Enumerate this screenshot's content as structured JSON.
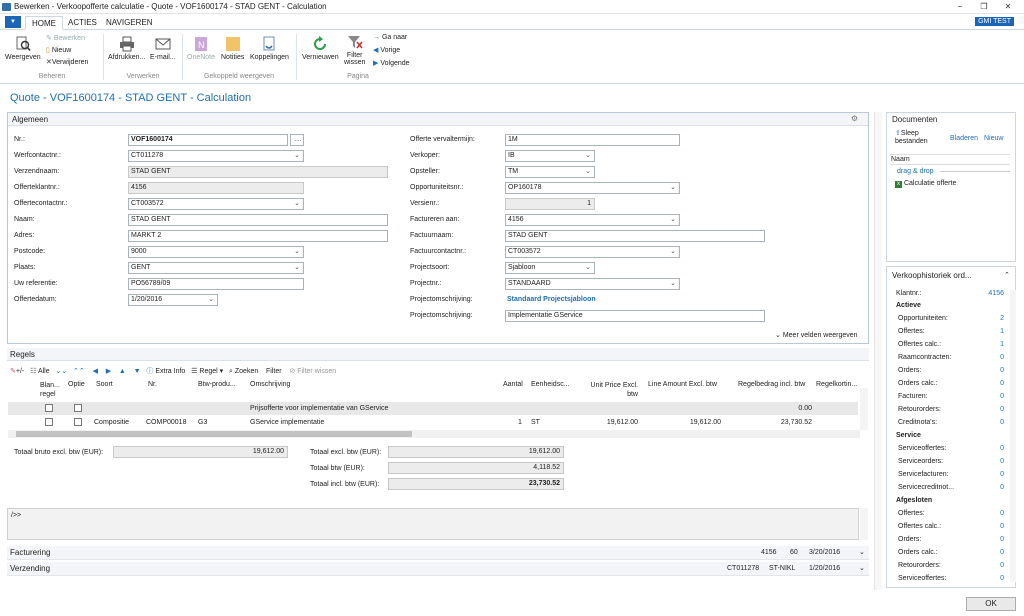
{
  "window": {
    "title": "Bewerken - Verkoopofferte calculatie - Quote - VOF1600174 - STAD GENT - Calculation",
    "min": "−",
    "restore": "❐",
    "close": "✕"
  },
  "ribbon_tabs": [
    "HOME",
    "ACTIES",
    "NAVIGEREN"
  ],
  "user_badge": "GMI TEST",
  "ribbon": {
    "beheren": {
      "weergeven": "Weergeven",
      "bewerken": "Bewerken",
      "nieuw": "Nieuw",
      "verwijderen": "Verwijderen",
      "group": "Beheren"
    },
    "verwerken": {
      "afdrukken": "Afdrukken...",
      "email": "E-mail...",
      "group": "Verwerken"
    },
    "gekoppeld": {
      "onenote": "OneNote",
      "notities": "Notities",
      "koppelingen": "Koppelingen",
      "group": "Gekoppeld weergeven"
    },
    "pagina": {
      "vernieuwen": "Vernieuwen",
      "filter": "Filter",
      "wissen": "wissen",
      "ganaar": "Ga naar",
      "vorige": "Vorige",
      "volgende": "Volgende",
      "group": "Pagina"
    }
  },
  "page_title": "Quote - VOF1600174 - STAD GENT - Calculation",
  "algemeen": {
    "title": "Algemeen",
    "left": [
      {
        "label": "Nr.:",
        "value": "VOF1600174"
      },
      {
        "label": "Werfcontactnr.:",
        "value": "CT011278"
      },
      {
        "label": "Verzendnaam:",
        "value": "STAD GENT"
      },
      {
        "label": "Offerteklantnr.:",
        "value": "4156"
      },
      {
        "label": "Offertecontactnr.:",
        "value": "CT003572"
      },
      {
        "label": "Naam:",
        "value": "STAD GENT"
      },
      {
        "label": "Adres:",
        "value": "MARKT 2"
      },
      {
        "label": "Postcode:",
        "value": "9000"
      },
      {
        "label": "Plaats:",
        "value": "GENT"
      },
      {
        "label": "Uw referentie:",
        "value": "PO56789/09"
      },
      {
        "label": "Offertedatum:",
        "value": "1/20/2016"
      }
    ],
    "right": [
      {
        "label": "Offerte vervaltermijn:",
        "value": "1M"
      },
      {
        "label": "Verkoper:",
        "value": "IB"
      },
      {
        "label": "Opsteller:",
        "value": "TM"
      },
      {
        "label": "Opportuniteitsnr.:",
        "value": "OP160178"
      },
      {
        "label": "Versienr.:",
        "value": "1"
      },
      {
        "label": "Factureren aan:",
        "value": "4156"
      },
      {
        "label": "Factuurnaam:",
        "value": "STAD GENT"
      },
      {
        "label": "Factuurcontactnr.:",
        "value": "CT003572"
      },
      {
        "label": "Projectsoort:",
        "value": "Sjabloon"
      },
      {
        "label": "Projectnr.:",
        "value": "STANDAARD"
      },
      {
        "label": "Projectomschrijving:",
        "value": "Standaard Projectsjabloon"
      },
      {
        "label": "Projectomschrijving:",
        "value": "Implementatie GService"
      }
    ],
    "more": "Meer velden weergeven"
  },
  "regels": {
    "title": "Regels",
    "toolbar": {
      "plusmin": "+/-",
      "alle": "Alle",
      "extra": "Extra Info",
      "regel": "Regel",
      "zoeken": "Zoeken",
      "filter": "Filter",
      "filterwissen": "Filter wissen"
    },
    "headers": {
      "blanco": "Blan... regel",
      "optie": "Optie",
      "soort": "Soort",
      "nr": "Nr.",
      "btw": "Btw-produ...",
      "omschrijving": "Omschrijving",
      "aantal": "Aantal",
      "eenheid": "Eenheidsc...",
      "unitprice": "Unit Price Excl. btw",
      "lineamount": "Line Amount Excl. btw",
      "regelbedrag": "Regelbedrag incl. btw",
      "regelkort": "Regelkortin..."
    },
    "rows": [
      {
        "soort": "",
        "nr": "",
        "btw": "",
        "omschrijving": "Prijsofferte voor implementatie van GService",
        "aantal": "",
        "eenheid": "",
        "unitprice": "",
        "lineamount": "",
        "regelbedrag": "0.00"
      },
      {
        "soort": "Compositie",
        "nr": "COMP00018",
        "btw": "G3",
        "omschrijving": "GService implementatie",
        "aantal": "1",
        "eenheid": "ST",
        "unitprice": "19,612.00",
        "lineamount": "19,612.00",
        "regelbedrag": "23,730.52"
      }
    ]
  },
  "totals": {
    "bruto_label": "Totaal bruto excl. btw (EUR):",
    "bruto": "19,612.00",
    "excl_label": "Totaal excl. btw (EUR):",
    "excl": "19,612.00",
    "btw_label": "Totaal btw (EUR):",
    "btw": "4,118.52",
    "incl_label": "Totaal incl. btw (EUR):",
    "incl": "23,730.52"
  },
  "notes_prompt": "/>>",
  "facturering": {
    "title": "Facturering",
    "a": "4156",
    "b": "60",
    "c": "3/20/2016"
  },
  "verzending": {
    "title": "Verzending",
    "a": "CT011278",
    "b": "ST-NIKL",
    "c": "1/20/2016"
  },
  "documenten": {
    "title": "Documenten",
    "sleep": "Sleep bestanden",
    "bladeren": "Bladeren",
    "nieuw": "Nieuw",
    "col": "Naam",
    "dragdrop": "drag & drop",
    "file": "Calculatie offerte"
  },
  "historiek": {
    "title": "Verkoophistoriek ord...",
    "klantnr_label": "Klantnr.:",
    "klantnr": "4156",
    "sections": [
      {
        "head": "Actieve",
        "rows": [
          [
            "Opportuniteiten:",
            "2"
          ],
          [
            "Offertes:",
            "1"
          ],
          [
            "Offertes calc.:",
            "1"
          ],
          [
            "Raamcontracten:",
            "0"
          ],
          [
            "Orders:",
            "0"
          ],
          [
            "Orders calc.:",
            "0"
          ],
          [
            "Facturen:",
            "0"
          ],
          [
            "Retourorders:",
            "0"
          ],
          [
            "Creditnota's:",
            "0"
          ]
        ]
      },
      {
        "head": "Service",
        "rows": [
          [
            "Serviceoffertes:",
            "0"
          ],
          [
            "Serviceorders:",
            "0"
          ],
          [
            "Servicefacturen:",
            "0"
          ],
          [
            "Servicecreditnot...",
            "0"
          ]
        ]
      },
      {
        "head": "Afgesloten",
        "rows": [
          [
            "Offertes:",
            "0"
          ],
          [
            "Offertes calc.:",
            "0"
          ],
          [
            "Orders:",
            "0"
          ],
          [
            "Orders calc.:",
            "0"
          ],
          [
            "Retourorders:",
            "0"
          ],
          [
            "Serviceoffertes:",
            "0"
          ]
        ]
      }
    ]
  },
  "ok": "OK"
}
